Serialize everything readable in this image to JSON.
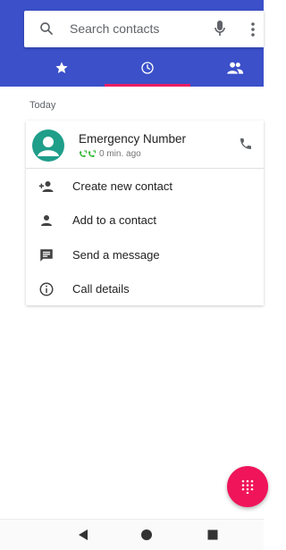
{
  "search": {
    "placeholder": "Search contacts",
    "icons": [
      "search-icon",
      "mic-icon",
      "more-vert-icon"
    ]
  },
  "tabs": [
    {
      "name": "favorites",
      "icon": "star-icon",
      "selected": false
    },
    {
      "name": "recents",
      "icon": "clock-icon",
      "selected": true
    },
    {
      "name": "contacts",
      "icon": "people-icon",
      "selected": false
    }
  ],
  "colors": {
    "appbar": "#3b50c9",
    "indicator": "#e91e63",
    "avatar": "#1f9e8a",
    "call_type": "#2eb82e",
    "fab": "#f0145a"
  },
  "call_log": {
    "section_header": "Today",
    "entry": {
      "name": "Emergency Number",
      "time": "0 min. ago",
      "call_type_icons": [
        "outgoing-call-icon",
        "outgoing-call-icon"
      ]
    },
    "actions": [
      {
        "label": "Create new contact",
        "icon": "person-add-icon"
      },
      {
        "label": "Add to a contact",
        "icon": "person-icon"
      },
      {
        "label": "Send a message",
        "icon": "message-icon"
      },
      {
        "label": "Call details",
        "icon": "info-icon"
      }
    ]
  },
  "fab": {
    "icon": "dialpad-icon"
  },
  "navigation": {
    "buttons": [
      "back-icon",
      "home-icon",
      "recents-icon"
    ]
  }
}
